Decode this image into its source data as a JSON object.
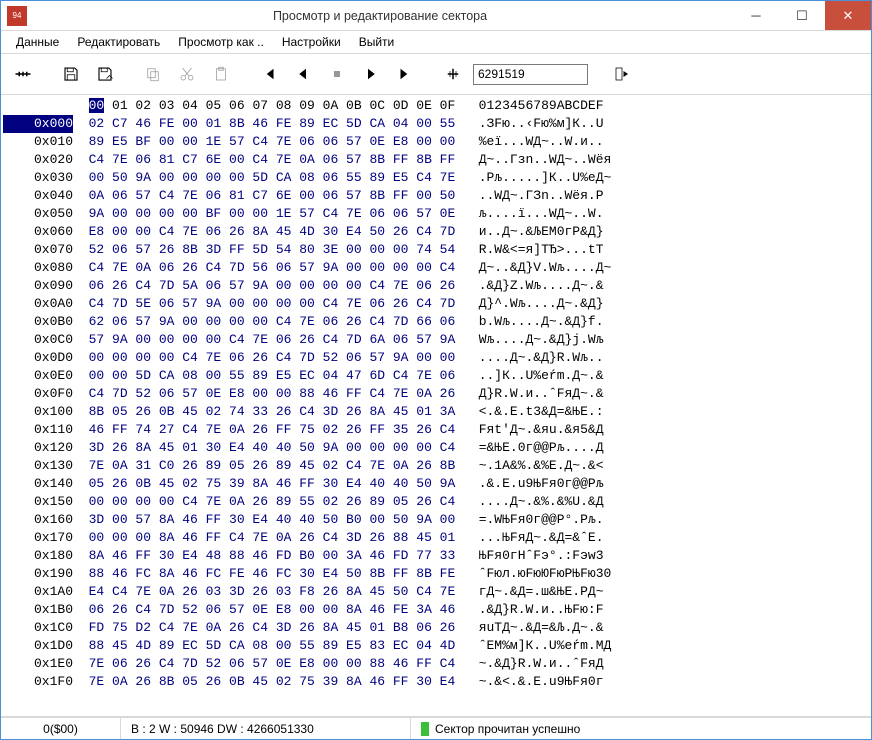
{
  "window": {
    "title": "Просмотр и редактирование сектора",
    "icon_text": "94"
  },
  "menu": {
    "items": [
      "Данные",
      "Редактировать",
      "Просмотр как ..",
      "Настройки",
      "Выйти"
    ]
  },
  "toolbar": {
    "sector_input": "6291519"
  },
  "status": {
    "left": "0($00)",
    "mid": "B : 2 W : 50946 DW : 4266051330",
    "right": "Сектор прочитан успешно"
  },
  "hex": {
    "header_offset": "",
    "cols": [
      "00",
      "01",
      "02",
      "03",
      "04",
      "05",
      "06",
      "07",
      "08",
      "09",
      "0A",
      "0B",
      "0C",
      "0D",
      "0E",
      "0F"
    ],
    "ascii_header": "0123456789ABCDEF",
    "rows": [
      {
        "o": "0x000",
        "h": [
          "02",
          "C7",
          "46",
          "FE",
          "00",
          "01",
          "8B",
          "46",
          "FE",
          "89",
          "EC",
          "5D",
          "CA",
          "04",
          "00",
          "55"
        ],
        "a": ".ЗFю..‹Fю%м]К..U"
      },
      {
        "o": "0x010",
        "h": [
          "89",
          "E5",
          "BF",
          "00",
          "00",
          "1E",
          "57",
          "C4",
          "7E",
          "06",
          "06",
          "57",
          "0E",
          "E8",
          "00",
          "00"
        ],
        "a": "%еї...WД~..W.и.."
      },
      {
        "o": "0x020",
        "h": [
          "C4",
          "7E",
          "06",
          "81",
          "C7",
          "6E",
          "00",
          "C4",
          "7E",
          "0A",
          "06",
          "57",
          "8B",
          "FF",
          "8B",
          "FF"
        ],
        "a": "Д~..Гзn..WД~..Wёя"
      },
      {
        "o": "0x030",
        "h": [
          "00",
          "50",
          "9A",
          "00",
          "00",
          "00",
          "00",
          "5D",
          "CA",
          "08",
          "06",
          "55",
          "89",
          "E5",
          "C4",
          "7E"
        ],
        "a": ".Рљ.....]К..U%еД~"
      },
      {
        "o": "0x040",
        "h": [
          "0A",
          "06",
          "57",
          "C4",
          "7E",
          "06",
          "81",
          "C7",
          "6E",
          "00",
          "06",
          "57",
          "8B",
          "FF",
          "00",
          "50"
        ],
        "a": "..WД~.ГЗn..Wёя.Р"
      },
      {
        "o": "0x050",
        "h": [
          "9A",
          "00",
          "00",
          "00",
          "00",
          "BF",
          "00",
          "00",
          "1E",
          "57",
          "C4",
          "7E",
          "06",
          "06",
          "57",
          "0E"
        ],
        "a": "љ....ї...WД~..W."
      },
      {
        "o": "0x060",
        "h": [
          "E8",
          "00",
          "00",
          "C4",
          "7E",
          "06",
          "26",
          "8A",
          "45",
          "4D",
          "30",
          "E4",
          "50",
          "26",
          "C4",
          "7D"
        ],
        "a": "и..Д~.&ЉEM0гP&Д}"
      },
      {
        "o": "0x070",
        "h": [
          "52",
          "06",
          "57",
          "26",
          "8B",
          "3D",
          "FF",
          "5D",
          "54",
          "80",
          "3E",
          "00",
          "00",
          "00",
          "74",
          "54"
        ],
        "a": "R.W&<=я]ТЂ>...tT"
      },
      {
        "o": "0x080",
        "h": [
          "C4",
          "7E",
          "0A",
          "06",
          "26",
          "C4",
          "7D",
          "56",
          "06",
          "57",
          "9A",
          "00",
          "00",
          "00",
          "00",
          "C4"
        ],
        "a": "Д~..&Д}V.Wљ....Д~"
      },
      {
        "o": "0x090",
        "h": [
          "06",
          "26",
          "C4",
          "7D",
          "5A",
          "06",
          "57",
          "9A",
          "00",
          "00",
          "00",
          "00",
          "C4",
          "7E",
          "06",
          "26"
        ],
        "a": ".&Д}Z.Wљ....Д~.&"
      },
      {
        "o": "0x0A0",
        "h": [
          "C4",
          "7D",
          "5E",
          "06",
          "57",
          "9A",
          "00",
          "00",
          "00",
          "00",
          "C4",
          "7E",
          "06",
          "26",
          "C4",
          "7D"
        ],
        "a": "Д}^.Wљ....Д~.&Д}"
      },
      {
        "o": "0x0B0",
        "h": [
          "62",
          "06",
          "57",
          "9A",
          "00",
          "00",
          "00",
          "00",
          "C4",
          "7E",
          "06",
          "26",
          "C4",
          "7D",
          "66",
          "06"
        ],
        "a": "b.Wљ....Д~.&Д}f."
      },
      {
        "o": "0x0C0",
        "h": [
          "57",
          "9A",
          "00",
          "00",
          "00",
          "00",
          "C4",
          "7E",
          "06",
          "26",
          "C4",
          "7D",
          "6A",
          "06",
          "57",
          "9A"
        ],
        "a": "Wљ....Д~.&Д}j.Wљ"
      },
      {
        "o": "0x0D0",
        "h": [
          "00",
          "00",
          "00",
          "00",
          "C4",
          "7E",
          "06",
          "26",
          "C4",
          "7D",
          "52",
          "06",
          "57",
          "9A",
          "00",
          "00"
        ],
        "a": "....Д~.&Д}R.Wљ.."
      },
      {
        "o": "0x0E0",
        "h": [
          "00",
          "00",
          "5D",
          "CA",
          "08",
          "00",
          "55",
          "89",
          "E5",
          "EC",
          "04",
          "47",
          "6D",
          "C4",
          "7E",
          "06"
        ],
        "a": "..]К..U%еŕm.Д~.&"
      },
      {
        "o": "0x0F0",
        "h": [
          "C4",
          "7D",
          "52",
          "06",
          "57",
          "0E",
          "E8",
          "00",
          "00",
          "88",
          "46",
          "FF",
          "C4",
          "7E",
          "0A",
          "26"
        ],
        "a": "Д}R.W.и..ˆFяД~.&"
      },
      {
        "o": "0x100",
        "h": [
          "8B",
          "05",
          "26",
          "0B",
          "45",
          "02",
          "74",
          "33",
          "26",
          "C4",
          "3D",
          "26",
          "8A",
          "45",
          "01",
          "3A"
        ],
        "a": "<.&.E.t3&Д=&ЊE.:"
      },
      {
        "o": "0x110",
        "h": [
          "46",
          "FF",
          "74",
          "27",
          "C4",
          "7E",
          "0A",
          "26",
          "FF",
          "75",
          "02",
          "26",
          "FF",
          "35",
          "26",
          "C4"
        ],
        "a": "Fяt'Д~.&яu.&я5&Д"
      },
      {
        "o": "0x120",
        "h": [
          "3D",
          "26",
          "8A",
          "45",
          "01",
          "30",
          "E4",
          "40",
          "40",
          "50",
          "9A",
          "00",
          "00",
          "00",
          "00",
          "C4"
        ],
        "a": "=&ЊE.0г@@Pљ....Д"
      },
      {
        "o": "0x130",
        "h": [
          "7E",
          "0A",
          "31",
          "C0",
          "26",
          "89",
          "05",
          "26",
          "89",
          "45",
          "02",
          "C4",
          "7E",
          "0A",
          "26",
          "8B"
        ],
        "a": "~.1А&%.&%E.Д~.&<"
      },
      {
        "o": "0x140",
        "h": [
          "05",
          "26",
          "0B",
          "45",
          "02",
          "75",
          "39",
          "8A",
          "46",
          "FF",
          "30",
          "E4",
          "40",
          "40",
          "50",
          "9A"
        ],
        "a": ".&.E.u9ЊFя0г@@Pљ"
      },
      {
        "o": "0x150",
        "h": [
          "00",
          "00",
          "00",
          "00",
          "C4",
          "7E",
          "0A",
          "26",
          "89",
          "55",
          "02",
          "26",
          "89",
          "05",
          "26",
          "C4"
        ],
        "a": "....Д~.&%.&%U.&Д"
      },
      {
        "o": "0x160",
        "h": [
          "3D",
          "00",
          "57",
          "8A",
          "46",
          "FF",
          "30",
          "E4",
          "40",
          "40",
          "50",
          "B0",
          "00",
          "50",
          "9A",
          "00"
        ],
        "a": "=.WЊFя0г@@P°.Pљ."
      },
      {
        "o": "0x170",
        "h": [
          "00",
          "00",
          "00",
          "8A",
          "46",
          "FF",
          "C4",
          "7E",
          "0A",
          "26",
          "C4",
          "3D",
          "26",
          "88",
          "45",
          "01"
        ],
        "a": "...ЊFяД~.&Д=&ˆE."
      },
      {
        "o": "0x180",
        "h": [
          "8A",
          "46",
          "FF",
          "30",
          "E4",
          "48",
          "88",
          "46",
          "FD",
          "B0",
          "00",
          "3A",
          "46",
          "FD",
          "77",
          "33"
        ],
        "a": "ЊFя0гHˆFэ°.:Fэw3"
      },
      {
        "o": "0x190",
        "h": [
          "88",
          "46",
          "FC",
          "8A",
          "46",
          "FC",
          "FE",
          "46",
          "FC",
          "30",
          "E4",
          "50",
          "8B",
          "FF",
          "8B",
          "FE"
        ],
        "a": "ˆFюл.юFюЮFюРЊFю30"
      },
      {
        "o": "0x1A0",
        "h": [
          "E4",
          "C4",
          "7E",
          "0A",
          "26",
          "03",
          "3D",
          "26",
          "03",
          "F8",
          "26",
          "8A",
          "45",
          "50",
          "C4",
          "7E"
        ],
        "a": "гД~.&Д=.ш&ЊE.РД~"
      },
      {
        "o": "0x1B0",
        "h": [
          "06",
          "26",
          "C4",
          "7D",
          "52",
          "06",
          "57",
          "0E",
          "E8",
          "00",
          "00",
          "8A",
          "46",
          "FE",
          "3A",
          "46"
        ],
        "a": ".&Д}R.W.и..ЊFю:F"
      },
      {
        "o": "0x1C0",
        "h": [
          "FD",
          "75",
          "D2",
          "C4",
          "7E",
          "0A",
          "26",
          "C4",
          "3D",
          "26",
          "8A",
          "45",
          "01",
          "B8",
          "06",
          "26"
        ],
        "a": "яuТД~.&Д=&Љ.Д~.&"
      },
      {
        "o": "0x1D0",
        "h": [
          "88",
          "45",
          "4D",
          "89",
          "EC",
          "5D",
          "CA",
          "08",
          "00",
          "55",
          "89",
          "E5",
          "83",
          "EC",
          "04",
          "4D"
        ],
        "a": "ˆEM%м]К..U%еŕm.MД"
      },
      {
        "o": "0x1E0",
        "h": [
          "7E",
          "06",
          "26",
          "C4",
          "7D",
          "52",
          "06",
          "57",
          "0E",
          "E8",
          "00",
          "00",
          "88",
          "46",
          "FF",
          "C4"
        ],
        "a": "~.&Д}R.W.и..ˆFяД"
      },
      {
        "o": "0x1F0",
        "h": [
          "7E",
          "0A",
          "26",
          "8B",
          "05",
          "26",
          "0B",
          "45",
          "02",
          "75",
          "39",
          "8A",
          "46",
          "FF",
          "30",
          "E4"
        ],
        "a": "~.&<.&.E.u9ЊFя0г"
      }
    ]
  }
}
